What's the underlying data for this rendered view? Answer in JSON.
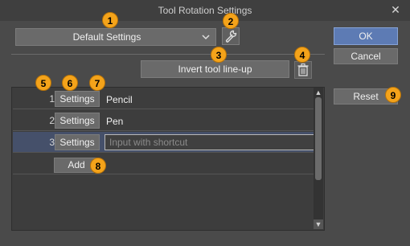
{
  "window": {
    "title": "Tool Rotation Settings"
  },
  "preset": {
    "selected": "Default Settings"
  },
  "buttons": {
    "ok": "OK",
    "cancel": "Cancel",
    "reset": "Reset",
    "invert": "Invert tool line-up",
    "add": "Add"
  },
  "rows": [
    {
      "num": "1",
      "settings": "Settings",
      "name": "Pencil"
    },
    {
      "num": "2",
      "settings": "Settings",
      "name": "Pen"
    },
    {
      "num": "3",
      "settings": "Settings",
      "shortcut_placeholder": "Input with shortcut"
    }
  ],
  "badges": [
    "1",
    "2",
    "3",
    "4",
    "5",
    "6",
    "7",
    "8",
    "9"
  ],
  "colors": {
    "accent": "#5d7bb4",
    "badge": "#f4a31a",
    "selected_row": "#45506a"
  },
  "icons": [
    "close-icon",
    "chevron-down-icon",
    "wrench-icon",
    "trash-icon",
    "scroll-up-icon",
    "scroll-down-icon"
  ]
}
